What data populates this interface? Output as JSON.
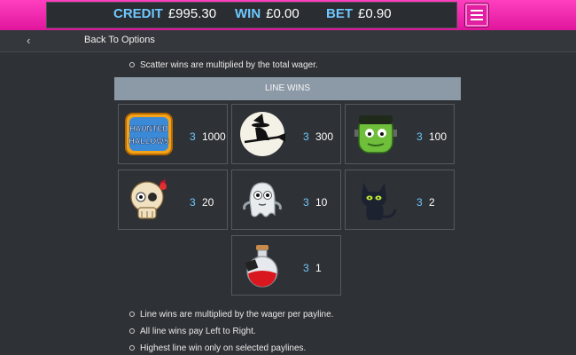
{
  "header": {
    "credit_label": "CREDIT",
    "credit_value": "£995.30",
    "win_label": "WIN",
    "win_value": "£0.00",
    "bet_label": "BET",
    "bet_value": "£0.90",
    "menu_icon": "hamburger-menu-icon"
  },
  "nav": {
    "back_label": "Back To Options",
    "back_icon": "chevron-left-icon"
  },
  "notes_top": [
    "Scatter wins are multiplied by the total wager."
  ],
  "section_title": "LINE WINS",
  "paytable": [
    {
      "symbol": "haunted-hallows-logo",
      "logo_text": "HAUNTED HALLOWS",
      "count": "3",
      "payout": "1000"
    },
    {
      "symbol": "witch-on-broom-icon",
      "count": "3",
      "payout": "300"
    },
    {
      "symbol": "frankenstein-icon",
      "count": "3",
      "payout": "100"
    },
    {
      "symbol": "skull-icon",
      "count": "3",
      "payout": "20"
    },
    {
      "symbol": "ghost-icon",
      "count": "3",
      "payout": "10"
    },
    {
      "symbol": "black-cat-icon",
      "count": "3",
      "payout": "2"
    },
    {
      "symbol": "potion-bottle-icon",
      "count": "3",
      "payout": "1"
    }
  ],
  "notes_bottom": [
    "Line wins are multiplied by the wager per payline.",
    "All line wins pay Left to Right.",
    "Highest line win only on selected paylines."
  ],
  "colors": {
    "accent_pink": "#e61aa3",
    "label_blue": "#6fc8ff",
    "header_bar": "#8c9aa8"
  }
}
